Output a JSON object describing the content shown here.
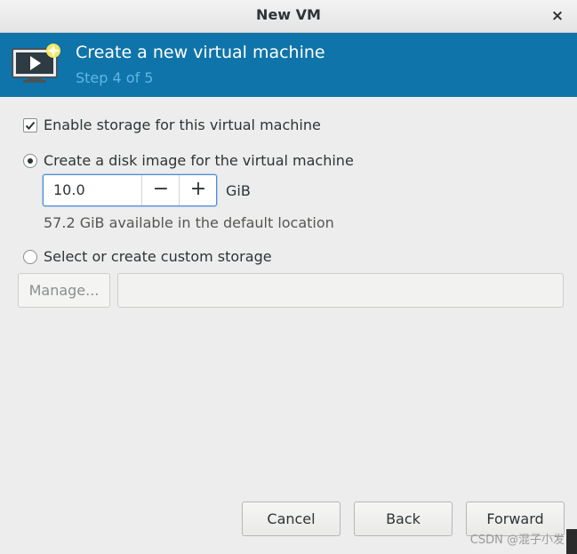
{
  "window": {
    "title": "New VM",
    "close_glyph": "×"
  },
  "header": {
    "title": "Create a new virtual machine",
    "step": "Step 4 of 5",
    "icon": "vm-monitor-icon",
    "bg_color": "#0f74a9",
    "step_color": "#5fb6e6"
  },
  "storage": {
    "enable_label": "Enable storage for this virtual machine",
    "enable_checked": true,
    "disk_image_label": "Create a disk image for the virtual machine",
    "disk_image_selected": true,
    "size_value": "10.0",
    "decrement_glyph": "−",
    "increment_glyph": "+",
    "size_unit": "GiB",
    "available_text": "57.2 GiB available in the default location",
    "custom_label": "Select or create custom storage",
    "custom_selected": false,
    "manage_label": "Manage...",
    "custom_path_value": ""
  },
  "footer": {
    "cancel_label": "Cancel",
    "back_label": "Back",
    "forward_label": "Forward"
  },
  "watermark": "CSDN @混子小发"
}
